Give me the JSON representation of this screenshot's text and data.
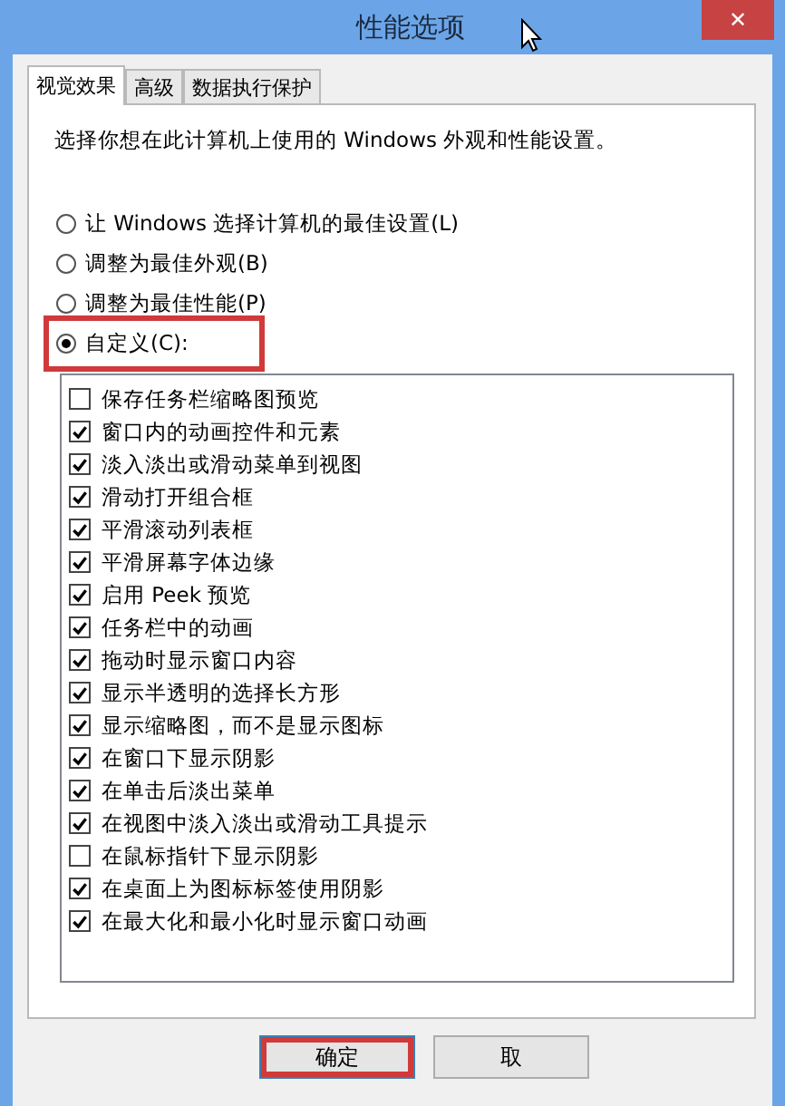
{
  "window": {
    "title": "性能选项",
    "close": "✕"
  },
  "tabs": [
    {
      "label": "视觉效果",
      "selected": true
    },
    {
      "label": "高级",
      "selected": false
    },
    {
      "label": "数据执行保护",
      "selected": false
    }
  ],
  "description": "选择你想在此计算机上使用的 Windows 外观和性能设置。",
  "radios": [
    {
      "label": "让 Windows 选择计算机的最佳设置(L)",
      "selected": false,
      "highlighted": false
    },
    {
      "label": "调整为最佳外观(B)",
      "selected": false,
      "highlighted": false
    },
    {
      "label": "调整为最佳性能(P)",
      "selected": false,
      "highlighted": false
    },
    {
      "label": "自定义(C):",
      "selected": true,
      "highlighted": true
    }
  ],
  "effects": [
    {
      "label": "保存任务栏缩略图预览",
      "checked": false
    },
    {
      "label": "窗口内的动画控件和元素",
      "checked": true
    },
    {
      "label": "淡入淡出或滑动菜单到视图",
      "checked": true
    },
    {
      "label": "滑动打开组合框",
      "checked": true
    },
    {
      "label": "平滑滚动列表框",
      "checked": true
    },
    {
      "label": "平滑屏幕字体边缘",
      "checked": true
    },
    {
      "label": "启用 Peek 预览",
      "checked": true
    },
    {
      "label": "任务栏中的动画",
      "checked": true
    },
    {
      "label": "拖动时显示窗口内容",
      "checked": true
    },
    {
      "label": "显示半透明的选择长方形",
      "checked": true
    },
    {
      "label": "显示缩略图，而不是显示图标",
      "checked": true
    },
    {
      "label": "在窗口下显示阴影",
      "checked": true
    },
    {
      "label": "在单击后淡出菜单",
      "checked": true
    },
    {
      "label": "在视图中淡入淡出或滑动工具提示",
      "checked": true
    },
    {
      "label": "在鼠标指针下显示阴影",
      "checked": false
    },
    {
      "label": "在桌面上为图标标签使用阴影",
      "checked": true
    },
    {
      "label": "在最大化和最小化时显示窗口动画",
      "checked": true
    }
  ],
  "buttons": [
    {
      "label": "确定",
      "highlighted": true
    },
    {
      "label": "取",
      "highlighted": false
    }
  ]
}
